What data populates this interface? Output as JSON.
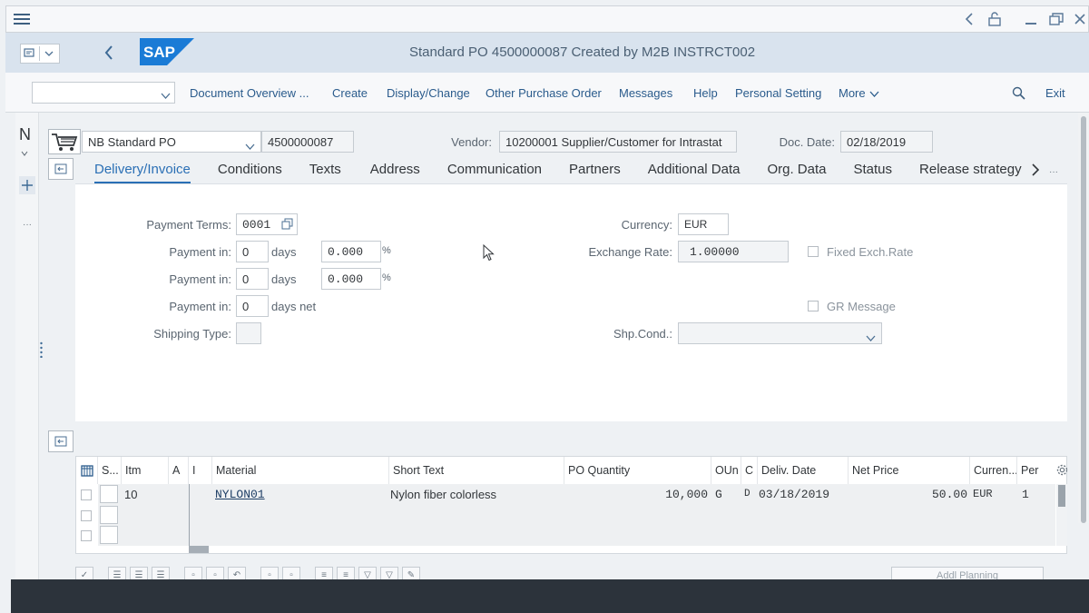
{
  "shell": {
    "menu_icon": "hamburger-icon",
    "right_icons": [
      "chevron-left-icon",
      "unlock-icon",
      "minimize-icon",
      "restore-icon",
      "close-icon"
    ]
  },
  "header": {
    "title": "Standard PO 4500000087 Created by M2B INSTRCT002",
    "logo_text": "SAP"
  },
  "toolbar": {
    "command_value": "",
    "items": [
      "Document Overview ...",
      "Create",
      "Display/Change",
      "Other Purchase Order",
      "Messages",
      "Help",
      "Personal Setting"
    ],
    "more": "More",
    "exit": "Exit"
  },
  "doc_header": {
    "doc_type": "NB Standard PO",
    "po_number": "4500000087",
    "vendor_label": "Vendor:",
    "vendor_value": "10200001 Supplier/Customer for Intrastat",
    "doc_date_label": "Doc. Date:",
    "doc_date_value": "02/18/2019"
  },
  "tabs": [
    "Delivery/Invoice",
    "Conditions",
    "Texts",
    "Address",
    "Communication",
    "Partners",
    "Additional Data",
    "Org. Data",
    "Status",
    "Release strategy"
  ],
  "form": {
    "payment_terms_label": "Payment Terms:",
    "payment_terms_value": "0001",
    "payment_in_label": "Payment in:",
    "p1_days": "0",
    "p1_pct": "0.000",
    "p2_days": "0",
    "p2_pct": "0.000",
    "p3_days": "0",
    "days_label": "days",
    "days_net_label": "days net",
    "percent_sign": "%",
    "shipping_type_label": "Shipping Type:",
    "currency_label": "Currency:",
    "currency_value": "EUR",
    "exchange_rate_label": "Exchange Rate:",
    "exchange_rate_value": "1.00000",
    "fixed_exch_label": "Fixed Exch.Rate",
    "gr_message_label": "GR Message",
    "shp_cond_label": "Shp.Cond.:"
  },
  "grid": {
    "columns": [
      "S...",
      "Itm",
      "A",
      "I",
      "Material",
      "Short Text",
      "PO Quantity",
      "OUn",
      "C",
      "Deliv. Date",
      "Net Price",
      "Curren...",
      "Per"
    ],
    "rows": [
      {
        "itm": "10",
        "material": "NYLON01",
        "short_text": "Nylon fiber colorless",
        "qty": "10,000",
        "oun": "G",
        "c": "D",
        "deliv_date": "03/18/2019",
        "net_price": "50.00",
        "currency": "EUR",
        "per": "1"
      }
    ]
  },
  "bottom": {
    "addl_planning": "Addl Planning"
  }
}
